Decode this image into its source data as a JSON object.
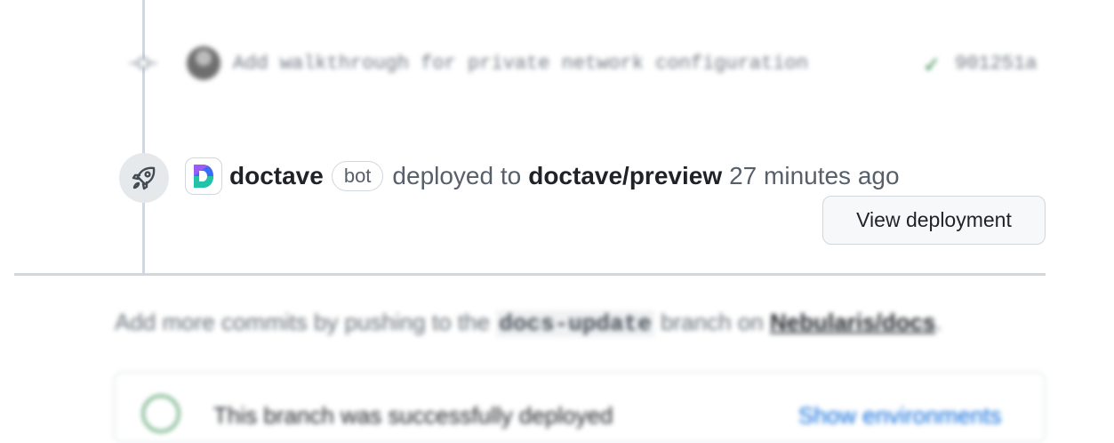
{
  "commit": {
    "message": "Add walkthrough for private network configuration",
    "sha": "901251a",
    "status_icon": "check-icon"
  },
  "deployment": {
    "actor": "doctave",
    "actor_badge": "bot",
    "action_text": "deployed to",
    "environment": "doctave/preview",
    "time_ago": "27 minutes ago",
    "view_button_label": "View deployment",
    "icon": "rocket-icon"
  },
  "footer": {
    "hint_prefix": "Add more commits by pushing to the",
    "branch": "docs-update",
    "hint_middle": "branch on",
    "repo": "Nebularis/docs",
    "hint_suffix": ".",
    "status_text": "This branch was successfully deployed",
    "status_link": "Show environments"
  },
  "colors": {
    "accent_green": "#1a7f37",
    "link_blue": "#0969da",
    "border": "#d0d7de"
  }
}
